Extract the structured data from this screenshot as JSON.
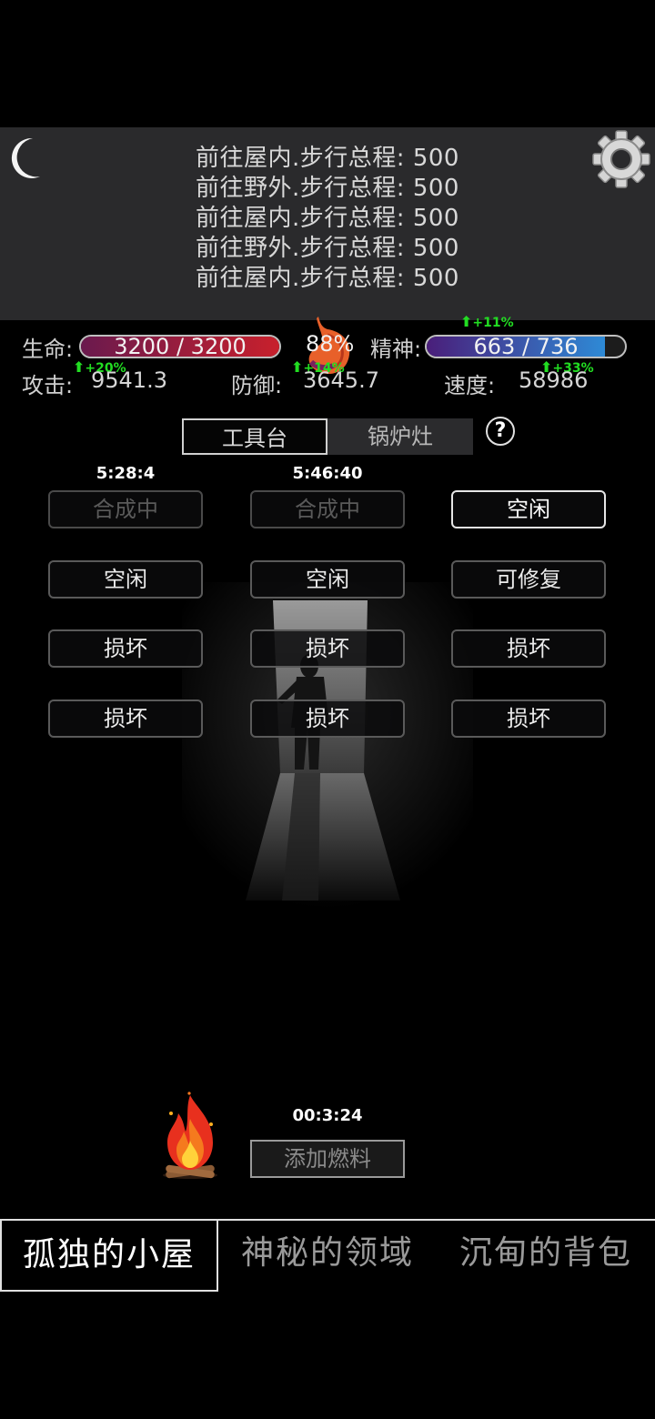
{
  "log": {
    "lines": [
      "前往屋内.步行总程: 500",
      "前往野外.步行总程: 500",
      "前往屋内.步行总程: 500",
      "前往野外.步行总程: 500",
      "前往屋内.步行总程: 500"
    ]
  },
  "stats": {
    "hp_label": "生命:",
    "hp_text": "3200 / 3200",
    "hp_fraction": 1.0,
    "satiety_pct": "88%",
    "spirit_label": "精神:",
    "spirit_text": "663 / 736",
    "spirit_fraction": 0.9,
    "spirit_boost": "+11%",
    "attack_label": "攻击:",
    "attack_value": "9541.3",
    "attack_boost": "+20%",
    "defense_label": "防御:",
    "defense_value": "3645.7",
    "defense_boost": "+14%",
    "speed_label": "速度:",
    "speed_value": "58986",
    "speed_boost": "+33%"
  },
  "tabs": {
    "workbench": "工具台",
    "stove": "锅炉灶",
    "help": "?"
  },
  "slots": [
    {
      "timer": "5:28:4",
      "label": "合成中",
      "state": "dim"
    },
    {
      "timer": "5:46:40",
      "label": "合成中",
      "state": "dim"
    },
    {
      "timer": "",
      "label": "空闲",
      "state": "bright"
    },
    {
      "timer": "",
      "label": "空闲",
      "state": "normal"
    },
    {
      "timer": "",
      "label": "空闲",
      "state": "normal"
    },
    {
      "timer": "",
      "label": "可修复",
      "state": "normal"
    },
    {
      "timer": "",
      "label": "损坏",
      "state": "normal"
    },
    {
      "timer": "",
      "label": "损坏",
      "state": "normal"
    },
    {
      "timer": "",
      "label": "损坏",
      "state": "normal"
    },
    {
      "timer": "",
      "label": "损坏",
      "state": "normal"
    },
    {
      "timer": "",
      "label": "损坏",
      "state": "normal"
    },
    {
      "timer": "",
      "label": "损坏",
      "state": "normal"
    }
  ],
  "fire": {
    "timer": "00:3:24",
    "add_fuel_label": "添加燃料"
  },
  "nav": {
    "cabin": "孤独的小屋",
    "domain": "神秘的领域",
    "bag": "沉甸的背包"
  },
  "colors": {
    "hp_bar": "#c8202c",
    "spirit_bar": "#2e7fc8",
    "boost": "#22dd22"
  }
}
